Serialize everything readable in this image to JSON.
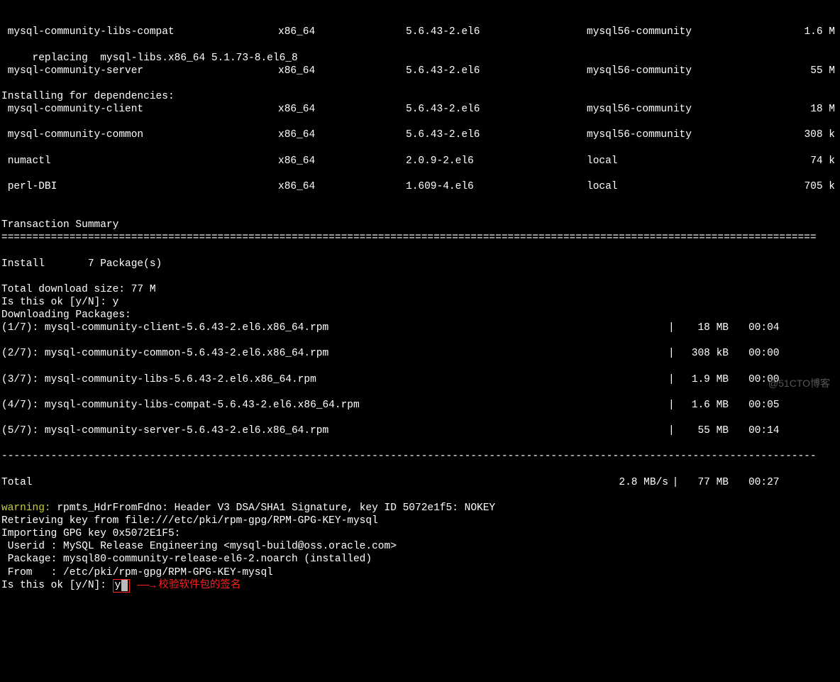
{
  "packages": [
    {
      "name": " mysql-community-libs-compat",
      "arch": "x86_64",
      "version": "5.6.43-2.el6",
      "repo": "mysql56-community",
      "size": "1.6 M"
    },
    {
      "name": " mysql-community-server",
      "arch": "x86_64",
      "version": "5.6.43-2.el6",
      "repo": "mysql56-community",
      "size": "55 M"
    },
    {
      "name": " mysql-community-client",
      "arch": "x86_64",
      "version": "5.6.43-2.el6",
      "repo": "mysql56-community",
      "size": "18 M"
    },
    {
      "name": " mysql-community-common",
      "arch": "x86_64",
      "version": "5.6.43-2.el6",
      "repo": "mysql56-community",
      "size": "308 k"
    },
    {
      "name": " numactl",
      "arch": "x86_64",
      "version": "2.0.9-2.el6",
      "repo": "local",
      "size": "74 k"
    },
    {
      "name": " perl-DBI",
      "arch": "x86_64",
      "version": "1.609-4.el6",
      "repo": "local",
      "size": "705 k"
    }
  ],
  "replacing_line": "     replacing  mysql-libs.x86_64 5.1.73-8.el6_8",
  "deps_header": "Installing for dependencies:",
  "summary_header": "Transaction Summary",
  "divider_double": "====================================================================================================================================",
  "install_count": "Install       7 Package(s)",
  "total_download_size": "Total download size: 77 M",
  "prompt_ok": "Is this ok [y/N]: ",
  "answer1": "y",
  "downloading_label": "Downloading Packages:",
  "downloads": [
    {
      "name": "(1/7): mysql-community-client-5.6.43-2.el6.x86_64.rpm",
      "size": " 18 MB",
      "time": "00:04     "
    },
    {
      "name": "(2/7): mysql-community-common-5.6.43-2.el6.x86_64.rpm",
      "size": "308 kB",
      "time": "00:00     "
    },
    {
      "name": "(3/7): mysql-community-libs-5.6.43-2.el6.x86_64.rpm",
      "size": "1.9 MB",
      "time": "00:00     "
    },
    {
      "name": "(4/7): mysql-community-libs-compat-5.6.43-2.el6.x86_64.rpm",
      "size": "1.6 MB",
      "time": "00:05     "
    },
    {
      "name": "(5/7): mysql-community-server-5.6.43-2.el6.x86_64.rpm",
      "size": " 55 MB",
      "time": "00:14     "
    }
  ],
  "divider_dash": "------------------------------------------------------------------------------------------------------------------------------------",
  "totals": {
    "label": "Total",
    "speed": "2.8 MB/s",
    "size": " 77 MB",
    "time": "00:27     "
  },
  "warning_prefix": "warning: ",
  "warning_rest": "rpmts_HdrFromFdno: Header V3 DSA/SHA1 Signature, key ID 5072e1f5: NOKEY",
  "retrieve_line": "Retrieving key from file:///etc/pki/rpm-gpg/RPM-GPG-KEY-mysql",
  "import_line": "Importing GPG key 0x5072E1F5:",
  "userid_line": " Userid : MySQL Release Engineering <mysql-build@oss.oracle.com>",
  "package_line": " Package: mysql80-community-release-el6-2.noarch (installed)",
  "from_line": " From   : /etc/pki/rpm-gpg/RPM-GPG-KEY-mysql",
  "answer2": "y",
  "annotation": "校验软件包的签名",
  "watermark": "@51CTO博客"
}
